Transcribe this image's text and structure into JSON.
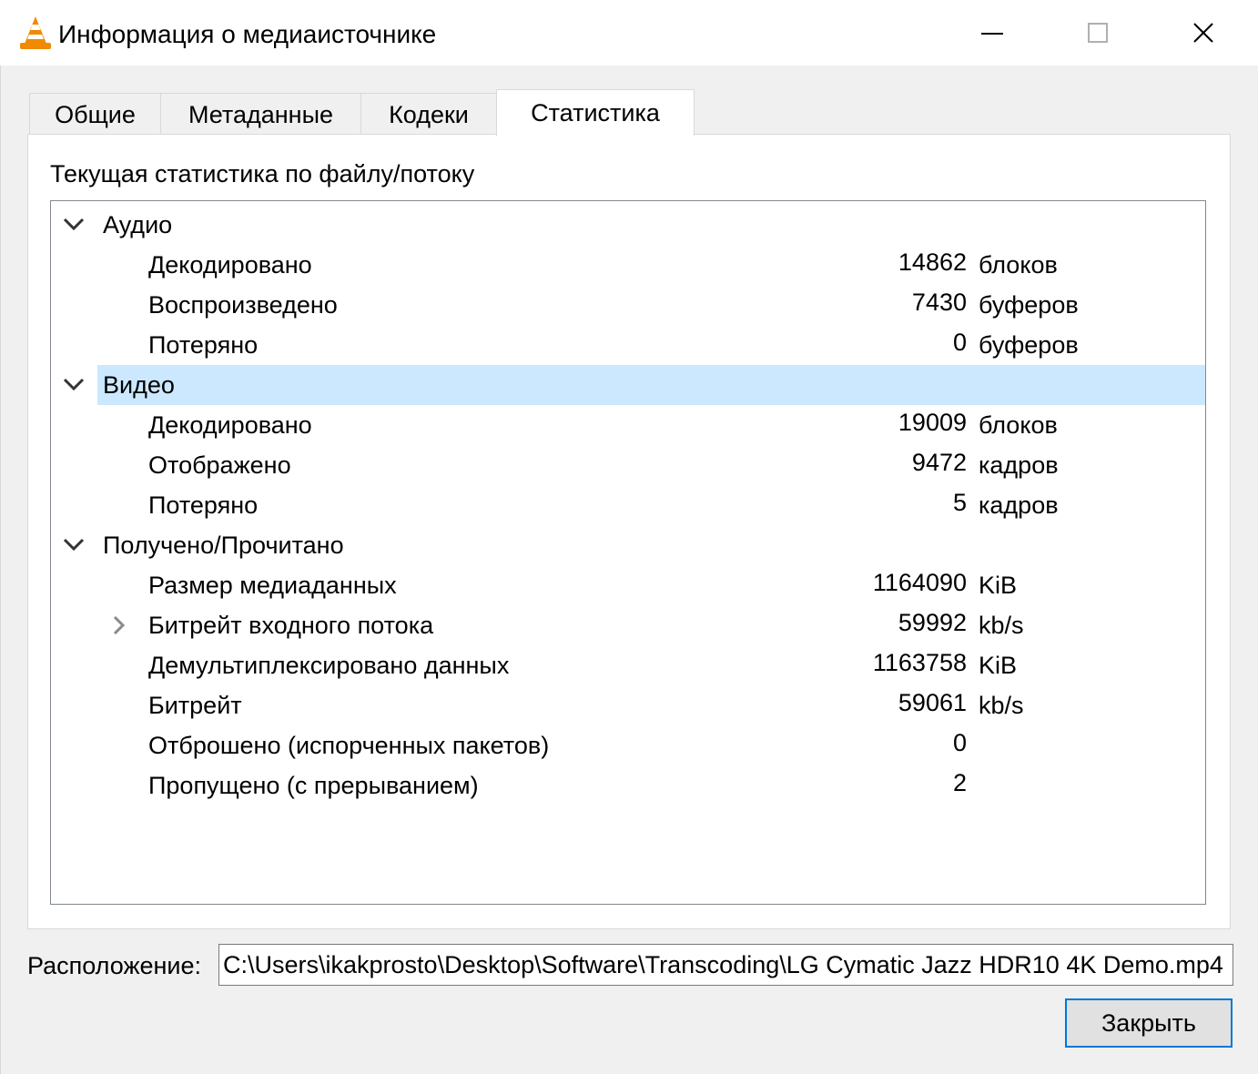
{
  "window": {
    "title": "Информация о медиаисточнике",
    "app_icon": "vlc-cone-icon"
  },
  "tabs": [
    {
      "label": "Общие",
      "active": false
    },
    {
      "label": "Метаданные",
      "active": false
    },
    {
      "label": "Кодеки",
      "active": false
    },
    {
      "label": "Статистика",
      "active": true
    }
  ],
  "stats": {
    "heading": "Текущая статистика по файлу/потоку",
    "groups": [
      {
        "label": "Аудио",
        "expanded": true,
        "selected": false,
        "items": [
          {
            "label": "Декодировано",
            "value": "14862",
            "unit": "блоков"
          },
          {
            "label": "Воспроизведено",
            "value": "7430",
            "unit": "буферов"
          },
          {
            "label": "Потеряно",
            "value": "0",
            "unit": "буферов"
          }
        ]
      },
      {
        "label": "Видео",
        "expanded": true,
        "selected": true,
        "items": [
          {
            "label": "Декодировано",
            "value": "19009",
            "unit": "блоков"
          },
          {
            "label": "Отображено",
            "value": "9472",
            "unit": "кадров"
          },
          {
            "label": "Потеряно",
            "value": "5",
            "unit": "кадров"
          }
        ]
      },
      {
        "label": "Получено/Прочитано",
        "expanded": true,
        "selected": false,
        "items": [
          {
            "label": "Размер медиаданных",
            "value": "1164090",
            "unit": "KiB"
          },
          {
            "label": "Битрейт входного потока",
            "value": "59992",
            "unit": "kb/s",
            "collapsible": true
          },
          {
            "label": "Демультиплексировано данных",
            "value": "1163758",
            "unit": "KiB"
          },
          {
            "label": "Битрейт",
            "value": "59061",
            "unit": "kb/s"
          },
          {
            "label": "Отброшено (испорченных пакетов)",
            "value": "0",
            "unit": ""
          },
          {
            "label": "Пропущено (с прерыванием)",
            "value": "2",
            "unit": ""
          }
        ]
      }
    ]
  },
  "location": {
    "label": "Расположение:",
    "value": "C:\\Users\\ikakprosto\\Desktop\\Software\\Transcoding\\LG Cymatic Jazz HDR10 4K Demo.mp4"
  },
  "buttons": {
    "close_label": "Закрыть"
  }
}
